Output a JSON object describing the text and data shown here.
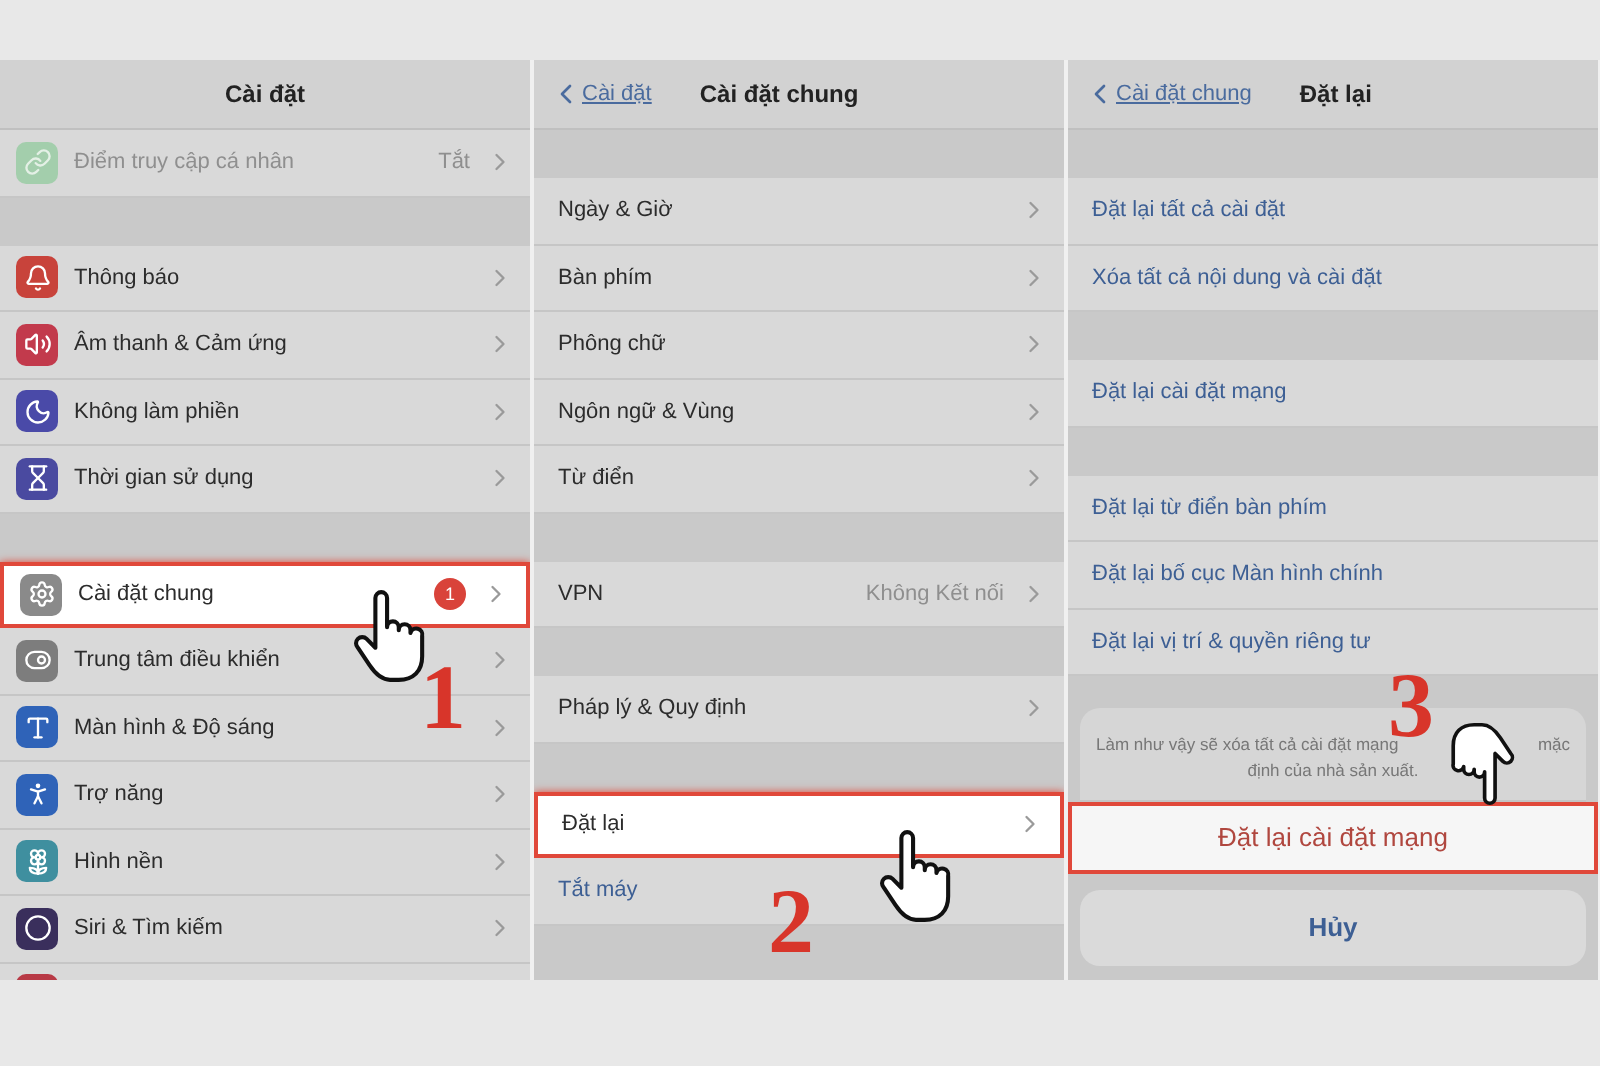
{
  "panels": [
    {
      "header": {
        "title": "Cài đặt"
      },
      "step": "1",
      "groups": [
        {
          "rows": [
            {
              "label": "Điểm truy cập cá nhân",
              "value": "Tắt",
              "color": "#a3ceac",
              "disabled": true,
              "highlighted": false
            }
          ]
        },
        {
          "rows": [
            {
              "label": "Thông báo",
              "color": "#c8433b",
              "highlighted": false
            },
            {
              "label": "Âm thanh & Cảm ứng",
              "color": "#c23a4c",
              "highlighted": false
            },
            {
              "label": "Không làm phiền",
              "color": "#4a4aa8",
              "highlighted": false
            },
            {
              "label": "Thời gian sử dụng",
              "color": "#4a4aa0",
              "highlighted": false
            }
          ]
        },
        {
          "rows": [
            {
              "label": "Cài đặt chung",
              "badge": "1",
              "color": "#8a8a8a",
              "highlighted": true
            },
            {
              "label": "Trung tâm điều khiển",
              "color": "#7d7d7d",
              "highlighted": false
            },
            {
              "label": "Màn hình & Độ sáng",
              "color": "#2f63b8",
              "highlighted": false
            },
            {
              "label": "Trợ năng",
              "color": "#2f63b8",
              "highlighted": false
            },
            {
              "label": "Hình nền",
              "color": "#3f8f9f",
              "highlighted": false
            },
            {
              "label": "Siri & Tìm kiếm",
              "color": "#3a2f5c",
              "highlighted": false
            },
            {
              "color": "#b83a46",
              "highlighted": false
            }
          ]
        }
      ]
    },
    {
      "header": {
        "back": "Cài đặt",
        "title": "Cài đặt chung"
      },
      "step": "2",
      "groups": [
        {
          "rows": [
            {
              "label": "Ngày & Giờ",
              "kind": "nav",
              "highlighted": false
            },
            {
              "label": "Bàn phím",
              "kind": "nav",
              "highlighted": false
            },
            {
              "label": "Phông chữ",
              "kind": "nav",
              "highlighted": false
            },
            {
              "label": "Ngôn ngữ & Vùng",
              "kind": "nav",
              "highlighted": false
            },
            {
              "label": "Từ điển",
              "kind": "nav",
              "highlighted": false
            }
          ]
        },
        {
          "rows": [
            {
              "label": "VPN",
              "value": "Không Kết nối",
              "kind": "nav",
              "highlighted": false
            }
          ]
        },
        {
          "rows": [
            {
              "label": "Pháp lý & Quy định",
              "kind": "nav",
              "highlighted": false
            }
          ]
        },
        {
          "rows": [
            {
              "label": "Đặt lại",
              "kind": "nav",
              "highlighted": true
            },
            {
              "label": "Tắt máy",
              "kind": "action",
              "highlighted": false
            }
          ]
        }
      ]
    },
    {
      "header": {
        "back": "Cài đặt chung",
        "title": "Đặt lại"
      },
      "step": "3",
      "groups": [
        {
          "rows": [
            {
              "label": "Đặt lại tất cả cài đặt",
              "kind": "action",
              "highlighted": false
            },
            {
              "label": "Xóa tất cả nội dung và cài đặt",
              "kind": "action",
              "highlighted": false
            }
          ]
        },
        {
          "rows": [
            {
              "label": "Đặt lại cài đặt mạng",
              "kind": "action",
              "highlighted": false
            }
          ]
        },
        {
          "rows": [
            {
              "label": "Đặt lại từ điển bàn phím",
              "kind": "action",
              "highlighted": false
            },
            {
              "label": "Đặt lại bố cục Màn hình chính",
              "kind": "action",
              "highlighted": false
            },
            {
              "label": "Đặt lại vị trí & quyền riêng tư",
              "kind": "action",
              "highlighted": false
            }
          ]
        }
      ],
      "dialog": {
        "message_parts": [
          "Làm như vậy sẽ xóa tất cả cài đặt mạng",
          "mặc",
          "định của nhà sản xuất."
        ],
        "confirm": {
          "label": "Đặt lại cài đặt mạng",
          "highlighted": true
        },
        "cancel": "Hủy"
      }
    }
  ]
}
